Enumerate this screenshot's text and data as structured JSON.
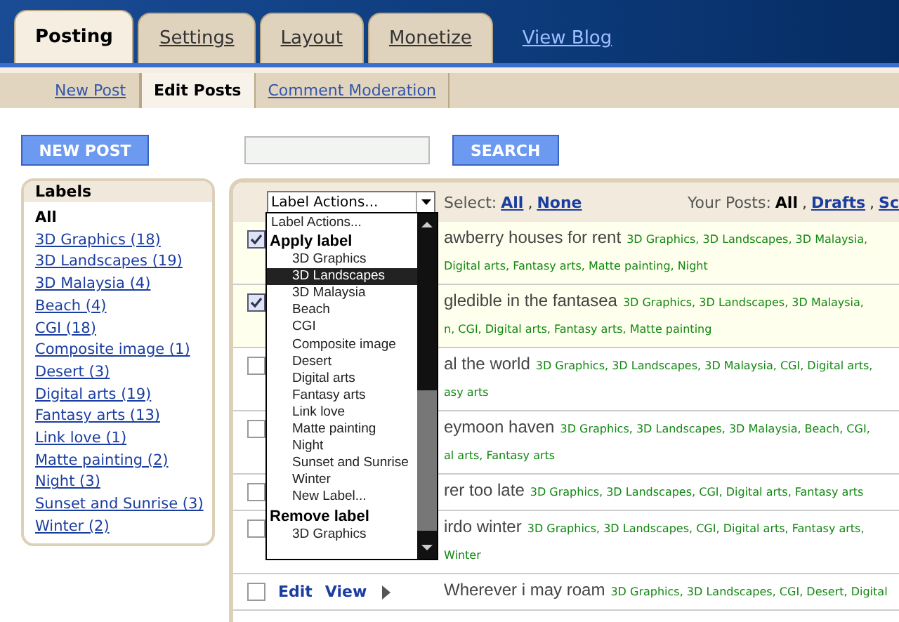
{
  "main_tabs": [
    {
      "label": "Posting",
      "selected": true
    },
    {
      "label": "Settings",
      "selected": false
    },
    {
      "label": "Layout",
      "selected": false
    },
    {
      "label": "Monetize",
      "selected": false
    }
  ],
  "view_blog": "View Blog",
  "sub_tabs": [
    {
      "label": "New Post",
      "selected": false
    },
    {
      "label": "Edit Posts",
      "selected": true
    },
    {
      "label": "Comment Moderation",
      "selected": false
    }
  ],
  "new_post_button": "NEW POST",
  "search_button": "SEARCH",
  "labels_panel": {
    "title": "Labels",
    "items": [
      {
        "text": "All",
        "selected": true
      },
      {
        "text": "3D Graphics (18)",
        "selected": false
      },
      {
        "text": "3D Landscapes (19)",
        "selected": false
      },
      {
        "text": "3D Malaysia (4)",
        "selected": false
      },
      {
        "text": "Beach (4)",
        "selected": false
      },
      {
        "text": "CGI (18)",
        "selected": false
      },
      {
        "text": "Composite image (1)",
        "selected": false
      },
      {
        "text": "Desert (3)",
        "selected": false
      },
      {
        "text": "Digital arts (19)",
        "selected": false
      },
      {
        "text": "Fantasy arts (13)",
        "selected": false
      },
      {
        "text": "Link love (1)",
        "selected": false
      },
      {
        "text": "Matte painting (2)",
        "selected": false
      },
      {
        "text": "Night (3)",
        "selected": false
      },
      {
        "text": "Sunset and Sunrise (3)",
        "selected": false
      },
      {
        "text": "Winter (2)",
        "selected": false
      }
    ]
  },
  "toolbar": {
    "label_actions": "Label Actions...",
    "select_label": "Select:",
    "select_links": [
      "All",
      "None"
    ],
    "separator": ",",
    "your_posts_label": "Your Posts:",
    "your_posts": [
      {
        "text": "All",
        "selected": true
      },
      {
        "text": "Drafts",
        "selected": false
      },
      {
        "text": "Sc",
        "selected": false
      }
    ]
  },
  "dropdown": [
    {
      "kind": "option",
      "text": "Label Actions...",
      "selected": false
    },
    {
      "kind": "header",
      "text": "Apply label",
      "selected": false
    },
    {
      "kind": "option",
      "text": "3D Graphics",
      "selected": false
    },
    {
      "kind": "option",
      "text": "3D Landscapes",
      "selected": true
    },
    {
      "kind": "option",
      "text": "3D Malaysia",
      "selected": false
    },
    {
      "kind": "option",
      "text": "Beach",
      "selected": false
    },
    {
      "kind": "option",
      "text": "CGI",
      "selected": false
    },
    {
      "kind": "option",
      "text": "Composite image",
      "selected": false
    },
    {
      "kind": "option",
      "text": "Desert",
      "selected": false
    },
    {
      "kind": "option",
      "text": "Digital arts",
      "selected": false
    },
    {
      "kind": "option",
      "text": "Fantasy arts",
      "selected": false
    },
    {
      "kind": "option",
      "text": "Link love",
      "selected": false
    },
    {
      "kind": "option",
      "text": "Matte painting",
      "selected": false
    },
    {
      "kind": "option",
      "text": "Night",
      "selected": false
    },
    {
      "kind": "option",
      "text": "Sunset and Sunrise",
      "selected": false
    },
    {
      "kind": "option",
      "text": "Winter",
      "selected": false
    },
    {
      "kind": "option",
      "text": "New Label...",
      "selected": false
    },
    {
      "kind": "header",
      "text": "Remove label",
      "selected": false
    },
    {
      "kind": "option",
      "text": "3D Graphics",
      "selected": false
    }
  ],
  "posts": [
    {
      "checked": true,
      "title": "awberry houses for rent",
      "labels": "3D Graphics, 3D Landscapes, 3D Malaysia,",
      "labels_2": "Digital arts, Fantasy arts, Matte painting, Night"
    },
    {
      "checked": true,
      "title": "gledible in the fantasea",
      "labels": "3D Graphics, 3D Landscapes, 3D Malaysia,",
      "labels_2": "n, CGI, Digital arts, Fantasy arts, Matte painting"
    },
    {
      "checked": false,
      "title": "al the world",
      "labels": "3D Graphics, 3D Landscapes, 3D Malaysia, CGI, Digital arts,",
      "labels_2": "asy arts"
    },
    {
      "checked": false,
      "title": "eymoon haven",
      "labels": "3D Graphics, 3D Landscapes, 3D Malaysia, Beach, CGI,",
      "labels_2": "al arts, Fantasy arts"
    },
    {
      "checked": false,
      "title": "rer too late",
      "labels": "3D Graphics, 3D Landscapes, CGI, Digital arts, Fantasy arts"
    },
    {
      "checked": false,
      "title": "irdo winter",
      "labels": "3D Graphics, 3D Landscapes, CGI, Digital arts, Fantasy arts,",
      "labels_2": "Winter"
    },
    {
      "checked": false,
      "edit": "Edit",
      "view": "View",
      "title": "Wherever i may roam",
      "labels": "3D Graphics, 3D Landscapes, CGI, Desert, Digital"
    }
  ]
}
